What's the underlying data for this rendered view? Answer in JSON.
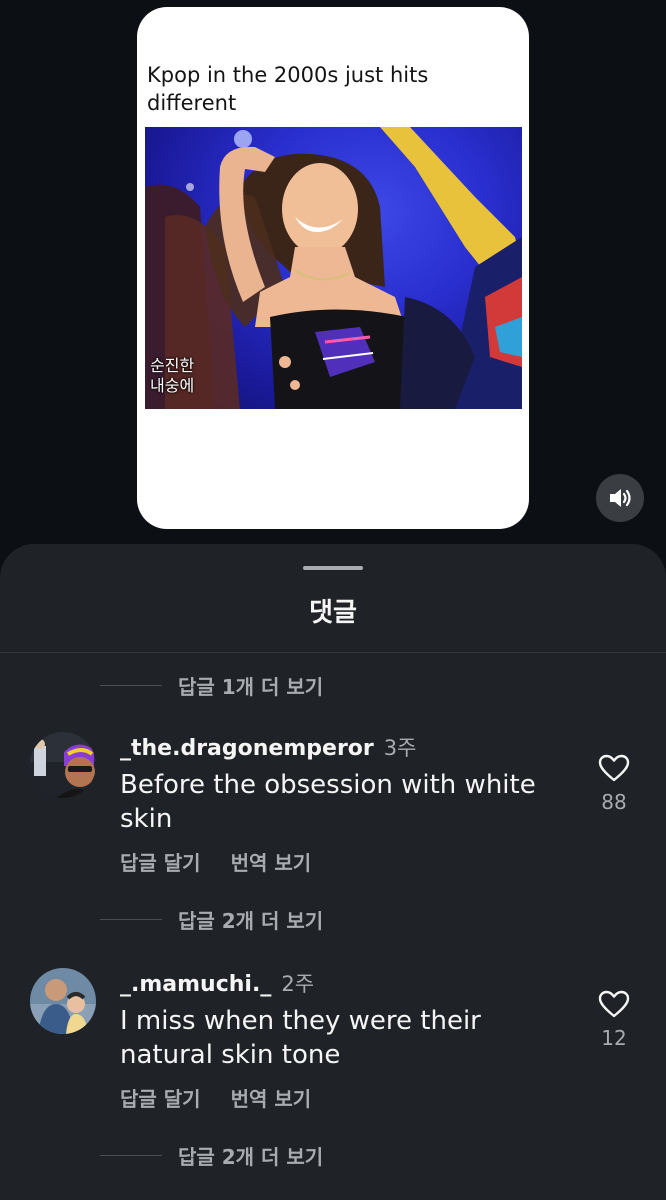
{
  "post": {
    "caption": "Kpop in the 2000s just hits different",
    "video_subtitle_line1": "순진한",
    "video_subtitle_line2": "내숭에",
    "sound_icon": "speaker-icon"
  },
  "comments_sheet": {
    "title": "댓글",
    "more_replies_top": "답글 1개 더 보기",
    "comments": [
      {
        "username": "_the.dragonemperor",
        "time": "3주",
        "text": "Before the obsession with white skin",
        "reply_label": "답글 달기",
        "translate_label": "번역 보기",
        "likes": "88",
        "more_replies": "답글 2개 더 보기"
      },
      {
        "username": "_.mamuchi._",
        "time": "2주",
        "text": "I miss when they were their natural skin tone",
        "reply_label": "답글 달기",
        "translate_label": "번역 보기",
        "likes": "12",
        "more_replies": "답글 2개 더 보기"
      }
    ]
  },
  "colors": {
    "background": "#0c1014",
    "sheet": "#1f2226",
    "primary_text": "#f5f5f5",
    "secondary_text": "#a8acb0"
  }
}
